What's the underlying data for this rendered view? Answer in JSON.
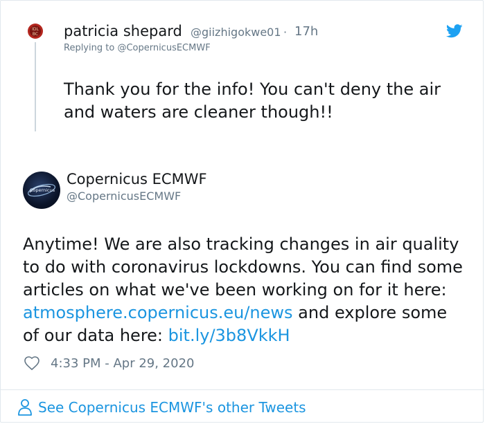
{
  "reply": {
    "author_name": "patricia shepard",
    "author_handle": "@giizhigokwe01",
    "separator": "·",
    "time": "17h",
    "replying_prefix": "Replying to ",
    "replying_handle": "@CopernicusECMWF",
    "text_line1": "Thank you for the info! You can't deny the air",
    "text_line2": "and waters are cleaner though!!"
  },
  "tweet": {
    "author_name": "Copernicus ECMWF",
    "author_handle": "@CopernicusECMWF",
    "avatar_text": "Copernicus",
    "text_line1": "Anytime! We are also tracking changes in air quality",
    "text_line2": "to do with coronavirus lockdowns. You can find some",
    "text_line3": "articles on what we've been working on for it here:",
    "link1": "atmosphere.copernicus.eu/news",
    "text_line4_rest": " and explore some",
    "text_line5_start": "of our data here: ",
    "link2": "bit.ly/3b8VkkH",
    "timestamp": "4:33 PM - Apr 29, 2020"
  },
  "footer": {
    "see_more": "See Copernicus ECMWF's other Tweets"
  },
  "icons": {
    "bird": "twitter-bird-icon",
    "heart": "heart-icon",
    "person": "person-icon"
  },
  "colors": {
    "link": "#1b95e0",
    "bird": "#1da1f2",
    "muted": "#657786",
    "text": "#14171a"
  }
}
